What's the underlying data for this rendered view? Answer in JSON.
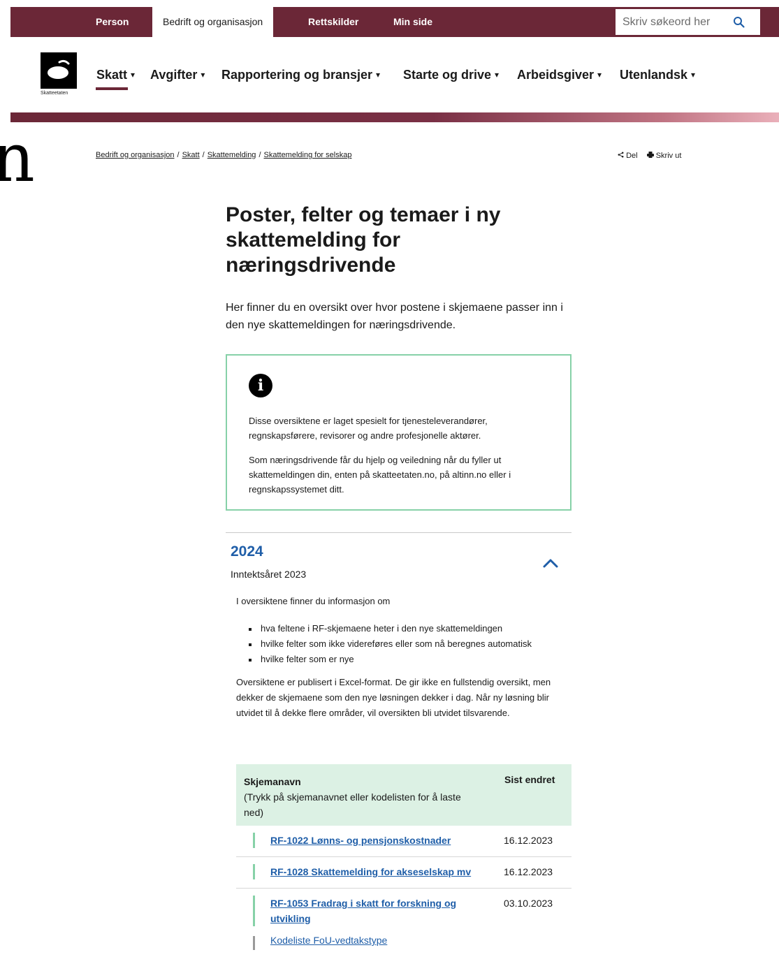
{
  "topbar": {
    "tabs": [
      {
        "label": "Person",
        "active": false
      },
      {
        "label": "Bedrift og organisasjon",
        "active": true
      },
      {
        "label": "Rettskilder",
        "active": false
      },
      {
        "label": "Min side",
        "active": false
      }
    ],
    "search_placeholder": "Skriv søkeord her",
    "brand_color": "#6b2737"
  },
  "logo": {
    "caption": "Skatteetaten"
  },
  "mainnav": {
    "items": [
      {
        "label": "Skatt",
        "active": true
      },
      {
        "label": "Avgifter",
        "active": false
      },
      {
        "label": "Rapportering og bransjer",
        "active": false
      },
      {
        "label": "Starte og drive",
        "active": false
      },
      {
        "label": "Arbeidsgiver",
        "active": false
      },
      {
        "label": "Utenlandsk",
        "active": false
      }
    ],
    "caret": "▾"
  },
  "edge_fragment": "n",
  "breadcrumb": {
    "items": [
      "Bedrift og organisasjon",
      "Skatt",
      "Skattemelding",
      "Skattemelding for selskap"
    ],
    "separator": "/"
  },
  "tools": {
    "share_label": "Del",
    "print_label": "Skriv ut"
  },
  "article": {
    "title": "Poster, felter og temaer i ny skattemelding for næringsdrivende",
    "lede": "Her finner du en oversikt over hvor postene i skjemaene passer inn i den nye skattemeldingen for næringsdrivende.",
    "info": {
      "p1": "Disse oversiktene er laget spesielt for tjenesteleverandører, regnskapsførere, revisorer og andre profesjonelle aktører.",
      "p2": "Som næringsdrivende får du hjelp og veiledning når du fyller ut skattemeldingen din, enten på skatteetaten.no, på altinn.no eller i regnskapssystemet ditt."
    },
    "accordion": {
      "year": "2024",
      "subtitle": "Inntektsåret 2023",
      "expanded": true,
      "intro": "I oversiktene finner du informasjon om",
      "bullets": [
        "hva feltene i RF-skjemaene heter i den nye skattemeldingen",
        "hvilke felter som ikke videreføres eller som nå beregnes automatisk",
        "hvilke felter som er nye"
      ],
      "para": "Oversiktene er publisert i Excel-format. De gir ikke en fullstendig oversikt, men dekker de skjemaene som den nye løsningen dekker i dag. Når ny løsning blir utvidet til å dekke flere områder, vil oversikten bli utvidet tilsvarende.",
      "table": {
        "header_name": "Skjemanavn",
        "header_name_note": "(Trykk på skjemanavnet eller kodelisten for å laste ned)",
        "header_date": "Sist endret",
        "rows": [
          {
            "name": "RF-1022 Lønns- og pensjonskostnader",
            "date": "16.12.2023"
          },
          {
            "name": "RF-1028 Skattemelding for akseselskap mv",
            "date": "16.12.2023"
          },
          {
            "name": "RF-1053 Fradrag i skatt for forskning og utvikling",
            "date": "03.10.2023"
          }
        ],
        "sub_link": "Kodeliste FoU-vedtakstype"
      }
    }
  }
}
